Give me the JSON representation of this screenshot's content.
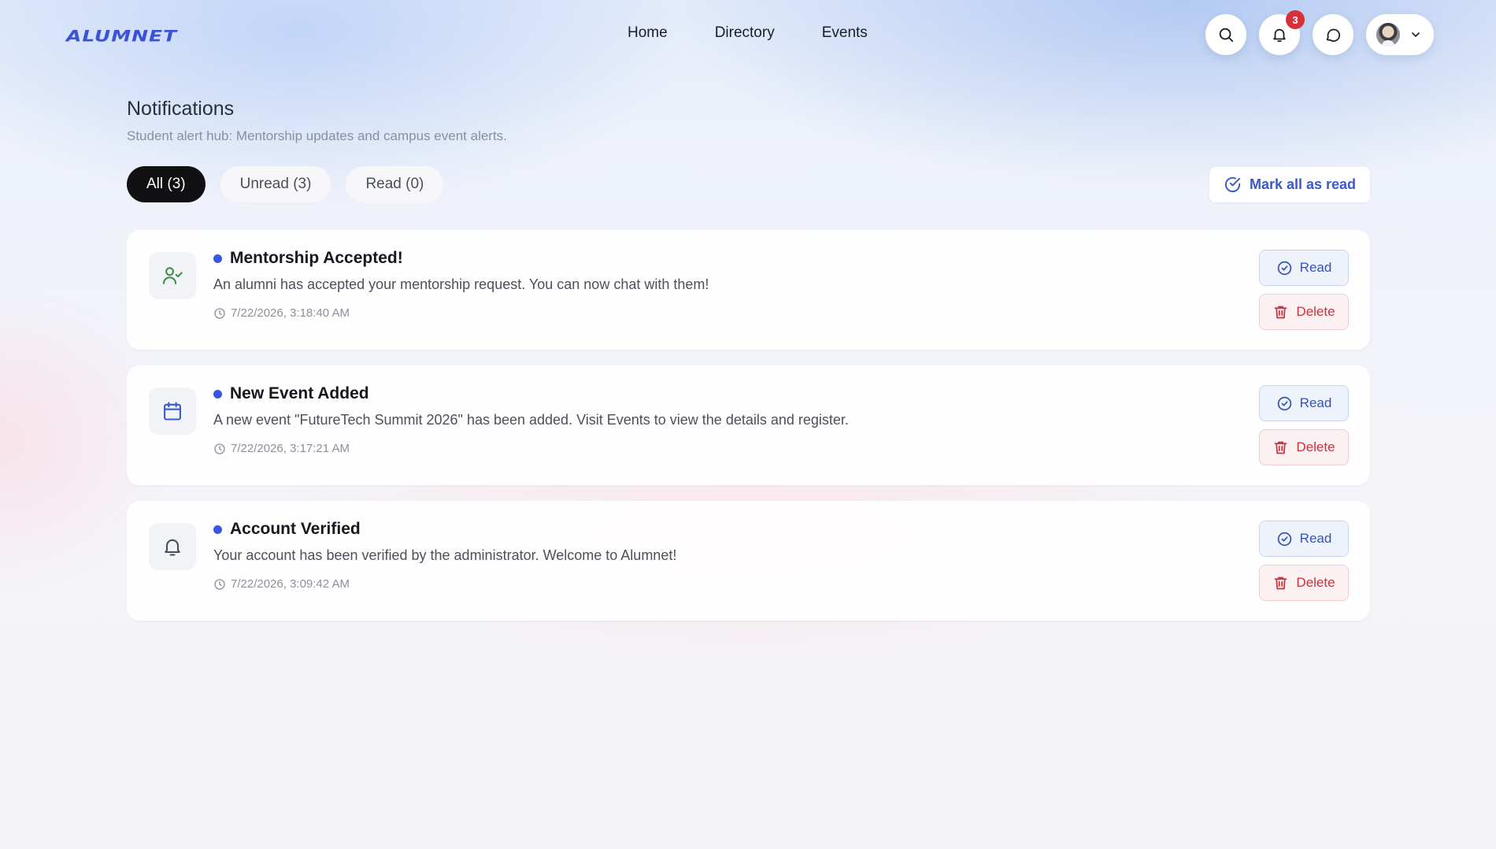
{
  "header": {
    "logo_text": "ALUMNET",
    "nav": [
      {
        "label": "Home"
      },
      {
        "label": "Directory"
      },
      {
        "label": "Events"
      }
    ],
    "notification_count": "3",
    "icons": [
      "search-icon",
      "bell-icon",
      "message-icon",
      "avatar",
      "chevron-down-icon"
    ]
  },
  "page": {
    "title": "Notifications",
    "subtitle": "Student alert hub: Mentorship updates and campus event alerts."
  },
  "filters": [
    {
      "label": "All (3)",
      "active": true
    },
    {
      "label": "Unread (3)",
      "active": false
    },
    {
      "label": "Read (0)",
      "active": false
    }
  ],
  "mark_all_label": "Mark all as read",
  "notifications": [
    {
      "icon": "user-check-icon",
      "icon_color": "#3f8f4f",
      "title": "Mentorship Accepted!",
      "message": "An alumni has accepted your mentorship request. You can now chat with them!",
      "time": "7/22/2026, 3:18:40 AM",
      "read_label": "Read",
      "delete_label": "Delete"
    },
    {
      "icon": "calendar-icon",
      "icon_color": "#3a5ad0",
      "title": "New Event Added",
      "message": "A new event \"FutureTech Summit 2026\" has been added. Visit Events to view the details and register.",
      "time": "7/22/2026, 3:17:21 AM",
      "read_label": "Read",
      "delete_label": "Delete"
    },
    {
      "icon": "bell-icon",
      "icon_color": "#4a4e59",
      "title": "Account Verified",
      "message": "Your account has been verified by the administrator. Welcome to Alumnet!",
      "time": "7/22/2026, 3:09:42 AM",
      "read_label": "Read",
      "delete_label": "Delete"
    }
  ],
  "colors": {
    "accent": "#3d57c8",
    "unread_dot": "#3656e6",
    "badge": "#d7303a",
    "delete": "#c8323c"
  }
}
